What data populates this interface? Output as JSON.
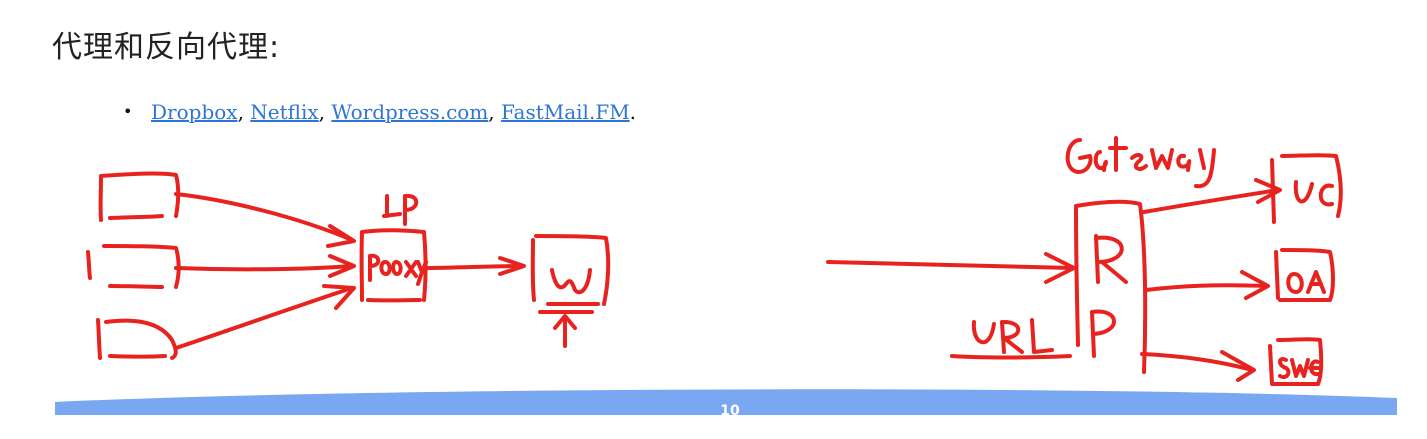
{
  "title": "代理和反向代理:",
  "bullet": {
    "links": [
      {
        "label": "Dropbox"
      },
      {
        "label": "Netflix"
      },
      {
        "label": "Wordpress.com"
      },
      {
        "label": "FastMail.FM"
      }
    ],
    "separator": ", ",
    "end": "."
  },
  "diagram_labels": {
    "ip": "IP",
    "proxy": "proxy",
    "web": "W",
    "gateway": "Gateway",
    "reverse_proxy_r": "R",
    "reverse_proxy_p": "P",
    "url": "URL",
    "target_1": "UC",
    "target_2": "OA",
    "target_3": "SWE"
  },
  "footer": {
    "page_number": "10"
  },
  "colors": {
    "ink": "#e8231f",
    "link": "#2e75d6",
    "band": "#7aa7f2"
  }
}
